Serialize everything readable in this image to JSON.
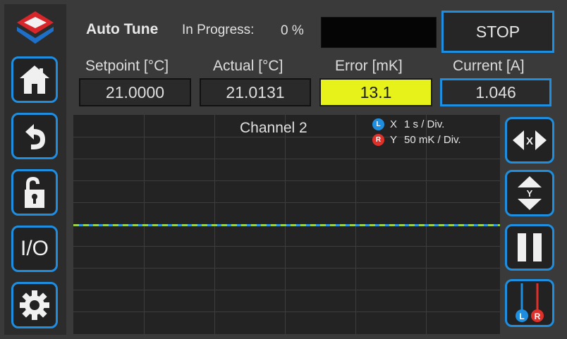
{
  "header": {
    "title": "Auto Tune",
    "status_label": "In Progress:",
    "progress_text": "0 %",
    "progress": 0,
    "stop_label": "STOP"
  },
  "readouts": {
    "setpoint": {
      "label": "Setpoint [°C]",
      "value": "21.0000"
    },
    "actual": {
      "label": "Actual [°C]",
      "value": "21.0131"
    },
    "error": {
      "label": "Error [mK]",
      "value": "13.1"
    },
    "current": {
      "label": "Current [A]",
      "value": "1.046"
    }
  },
  "graph": {
    "channel": "Channel 2",
    "legend": [
      {
        "badge": "L",
        "axis": "X",
        "text": "1 s / Div.",
        "color": "#1e8fe0"
      },
      {
        "badge": "R",
        "axis": "Y",
        "text": "50 mK / Div.",
        "color": "#e0302a"
      }
    ]
  },
  "sidebar": {
    "items": [
      {
        "name": "home-icon"
      },
      {
        "name": "back-icon"
      },
      {
        "name": "unlock-icon"
      },
      {
        "name": "io",
        "label": "I/O"
      },
      {
        "name": "gear-icon"
      }
    ]
  },
  "right_controls": {
    "x_badge": "X",
    "y_badge": "Y",
    "l_badge": "L",
    "r_badge": "R"
  },
  "colors": {
    "accent": "#1e8fe0",
    "error_bg": "#e6f21a",
    "trace_blue": "#2f8fe0",
    "trace_green": "#9ad04a",
    "right_red": "#e0302a"
  }
}
